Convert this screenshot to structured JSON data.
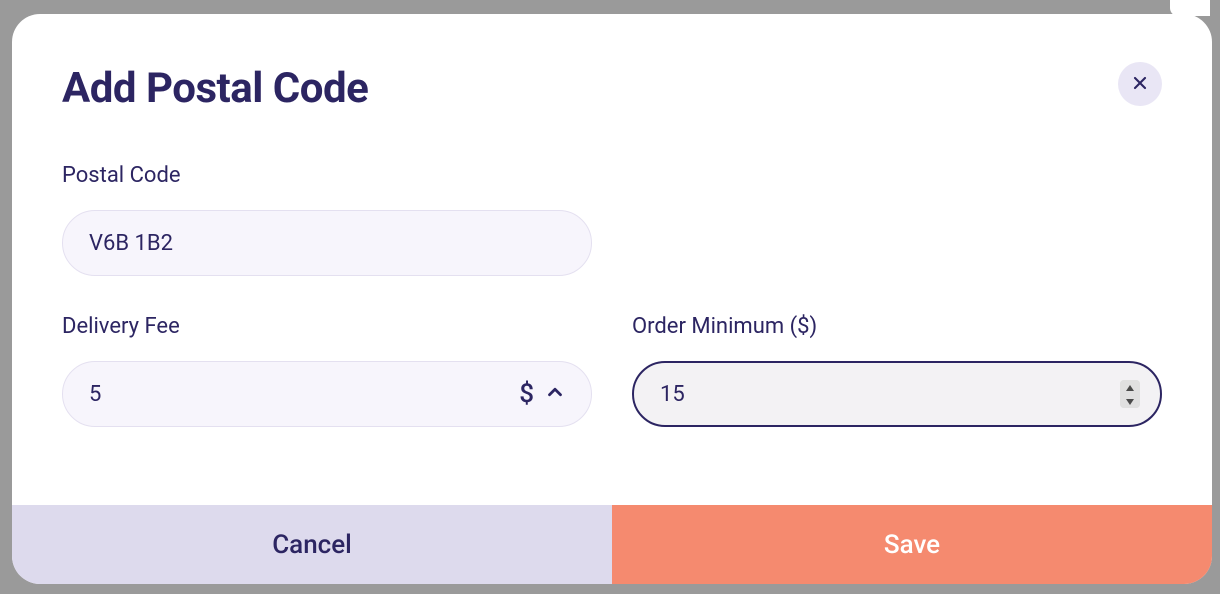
{
  "modal": {
    "title": "Add Postal Code",
    "postalCode": {
      "label": "Postal Code",
      "value": "V6B 1B2"
    },
    "deliveryFee": {
      "label": "Delivery Fee",
      "value": "5",
      "currencySymbol": "$"
    },
    "orderMinimum": {
      "label": "Order Minimum ($)",
      "value": "15"
    },
    "buttons": {
      "cancel": "Cancel",
      "save": "Save"
    }
  }
}
